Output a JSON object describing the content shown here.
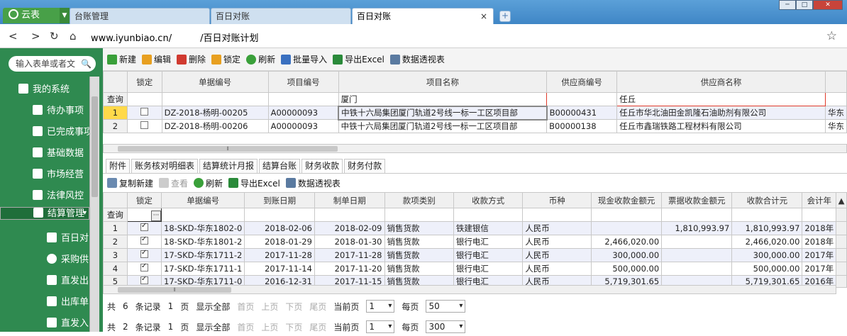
{
  "browser": {
    "brand": "云表",
    "tabs": [
      {
        "label": "台账管理"
      },
      {
        "label": "百日对账"
      },
      {
        "label": "百日对账"
      }
    ],
    "close_glyph": "×",
    "new_tab_glyph": "+",
    "url_domain": "www.iyunbiao.cn/",
    "url_path": "/百日对账计划"
  },
  "sidebar": {
    "search_placeholder": "输入表单或者文",
    "items": [
      {
        "label": "我的系统",
        "icon": "home-icon"
      },
      {
        "label": "待办事项",
        "icon": "list-icon"
      },
      {
        "label": "已完成事项",
        "icon": "list-icon"
      },
      {
        "label": "基础数据",
        "icon": "folder-icon"
      },
      {
        "label": "市场经营",
        "icon": "folder-icon"
      },
      {
        "label": "法律风控",
        "icon": "folder-icon"
      },
      {
        "label": "结算管理",
        "icon": "folder-icon"
      },
      {
        "label": "百日对",
        "icon": "folder-icon"
      },
      {
        "label": "采购供",
        "icon": "gear-icon"
      },
      {
        "label": "直发出",
        "icon": "doc-icon"
      },
      {
        "label": "出库单",
        "icon": "doc-icon"
      },
      {
        "label": "直发入",
        "icon": "doc-icon"
      }
    ]
  },
  "toolbar": {
    "new": "新建",
    "edit": "编辑",
    "delete": "删除",
    "lock": "锁定",
    "refresh": "刷新",
    "batch_import": "批量导入",
    "export_excel": "导出Excel",
    "pivot": "数据透视表"
  },
  "grid1": {
    "headers": [
      "锁定",
      "单据编号",
      "项目编号",
      "项目名称",
      "供应商编号",
      "供应商名称"
    ],
    "query_label": "查询",
    "filter_project": "厦门",
    "filter_supplier": "任丘",
    "rows": [
      {
        "n": "1",
        "code": "DZ-2018-杨明-00205",
        "proj": "A00000093",
        "name": "中铁十六局集团厦门轨道2号线一标一工区项目部",
        "sup": "B00000431",
        "sname": "任丘市华北油田金凯隆石油助剂有限公司",
        "extra": "华东"
      },
      {
        "n": "2",
        "code": "DZ-2018-杨明-00206",
        "proj": "A00000093",
        "name": "中铁十六局集团厦门轨道2号线一标一工区项目部",
        "sup": "B00000138",
        "sname": "任丘市鑫瑞铁路工程材料有限公司",
        "extra": "华东"
      }
    ]
  },
  "subtabs": [
    "附件",
    "账务核对明细表",
    "结算统计月报",
    "结算台账",
    "财务收款",
    "财务付款"
  ],
  "toolbar2": {
    "copy_new": "复制新建",
    "view": "查看",
    "refresh": "刷新",
    "export_excel": "导出Excel",
    "pivot": "数据透视表"
  },
  "grid2": {
    "headers": [
      "锁定",
      "单据编号",
      "到账日期",
      "制单日期",
      "款项类别",
      "收款方式",
      "币种",
      "现金收款金额元",
      "票据收款金额元",
      "收款合计元",
      "会计年"
    ],
    "query_label": "查询",
    "ellipsis": "···",
    "rows": [
      {
        "n": "1",
        "code": "18-SKD-华东1802-0",
        "arr": "2018-02-06",
        "made": "2018-02-09",
        "type": "销售货款",
        "way": "铁建银信",
        "cur": "人民币",
        "cash": "",
        "bill": "1,810,993.97",
        "total": "1,810,993.97",
        "year": "2018年"
      },
      {
        "n": "2",
        "code": "18-SKD-华东1801-2",
        "arr": "2018-01-29",
        "made": "2018-01-30",
        "type": "销售货款",
        "way": "银行电汇",
        "cur": "人民币",
        "cash": "2,466,020.00",
        "bill": "",
        "total": "2,466,020.00",
        "year": "2018年"
      },
      {
        "n": "3",
        "code": "17-SKD-华东1711-2",
        "arr": "2017-11-28",
        "made": "2017-11-28",
        "type": "销售货款",
        "way": "银行电汇",
        "cur": "人民币",
        "cash": "300,000.00",
        "bill": "",
        "total": "300,000.00",
        "year": "2017年"
      },
      {
        "n": "4",
        "code": "17-SKD-华东1711-1",
        "arr": "2017-11-14",
        "made": "2017-11-20",
        "type": "销售货款",
        "way": "银行电汇",
        "cur": "人民币",
        "cash": "500,000.00",
        "bill": "",
        "total": "500,000.00",
        "year": "2017年"
      },
      {
        "n": "5",
        "code": "17-SKD-华东1711-0",
        "arr": "2016-12-31",
        "made": "2017-11-15",
        "type": "销售货款",
        "way": "银行电汇",
        "cur": "人民币",
        "cash": "5,719,301.65",
        "bill": "",
        "total": "5,719,301.65",
        "year": "2016年"
      }
    ]
  },
  "pager1": {
    "total_label": "共",
    "count": "6",
    "records": "条记录",
    "pages": "1",
    "page_unit": "页",
    "show_all": "显示全部",
    "first": "首页",
    "prev": "上页",
    "next": "下页",
    "last": "尾页",
    "cur_label": "当前页",
    "cur": "1",
    "per_label": "每页",
    "per": "50"
  },
  "pager2": {
    "total_label": "共",
    "count": "2",
    "records": "条记录",
    "pages": "1",
    "page_unit": "页",
    "show_all": "显示全部",
    "first": "首页",
    "prev": "上页",
    "next": "下页",
    "last": "尾页",
    "cur_label": "当前页",
    "cur": "1",
    "per_label": "每页",
    "per": "300"
  },
  "colors": {
    "sidebar": "#2f8a50",
    "highlight": "#ffd94a",
    "filter_border": "#e03a2a",
    "tabbar": "#4a90cf"
  }
}
